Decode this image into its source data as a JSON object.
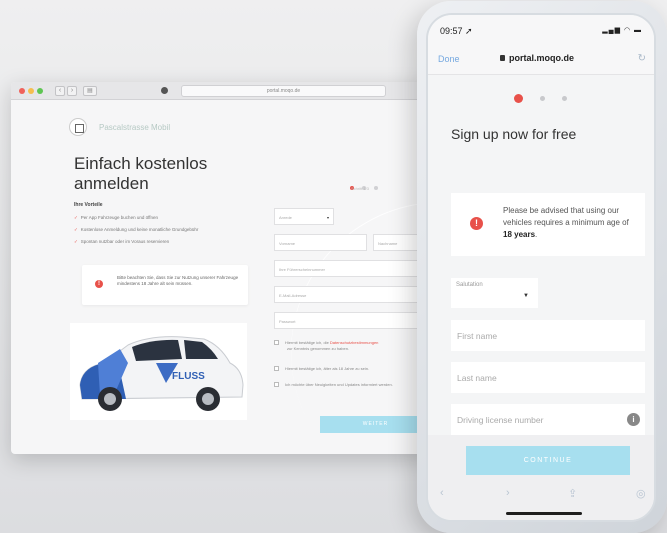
{
  "desktop": {
    "address": "portal.moqo.de",
    "brand": "Pascalstrasse Mobil",
    "title": "Einfach kostenlos anmelden",
    "step_label": "Schritt 1/3",
    "benefits_title": "Ihre Vorteile",
    "benefits": [
      "Per App Fahrzeuge buchen und öffnen",
      "Kostenlose Anmeldung und keine monatliche Grundgebühr",
      "Spontan nutzbar oder im Voraus reservieren"
    ],
    "notice": "Bitte beachten Sie, dass Sie zur Nutzung unserer Fahrzeuge mindestens 18 Jahre alt sein müssen.",
    "fields": {
      "salutation": "Anrede",
      "first_name": "Vorname",
      "last_name": "Nachname",
      "license": "Ihre Führerscheinnummer",
      "email": "E-Mail-Adresse",
      "password": "Passwort"
    },
    "checks": [
      {
        "pre": "Hiermit bestätige ich, die ",
        "link": "Datenschutzbestimmungen",
        "post": " zur Kenntnis genommen zu haben."
      },
      {
        "pre": "Hiermit bestätige ich, älter als 18 Jahre zu sein.",
        "link": "",
        "post": ""
      },
      {
        "pre": "Ich möchte über Neuigkeiten und Updates informiert werden.",
        "link": "",
        "post": ""
      }
    ],
    "submit": "WEITER",
    "car_brand": "FLUSS"
  },
  "phone": {
    "time": "09:57",
    "done": "Done",
    "url": "portal.moqo.de",
    "title": "Sign up now for free",
    "notice_pre": "Please be advised that using our vehicles requires a minimum age of",
    "notice_bold": "18 years",
    "notice_end": ".",
    "salutation_label": "Salutation",
    "first_name": "First name",
    "last_name": "Last name",
    "license": "Driving license number",
    "continue": "CONTINUE"
  },
  "colors": {
    "accent": "#e8514a",
    "button": "#a7dfef"
  }
}
